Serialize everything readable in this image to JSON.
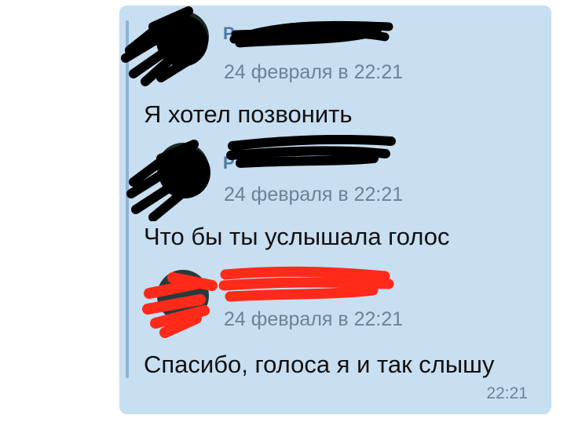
{
  "colors": {
    "bubble_bg": "#c8def1",
    "quote_bar": "#8fb3d4",
    "author": "#4a7aa8",
    "meta": "#6c8296",
    "text": "#111111",
    "redaction_black": "#000000",
    "redaction_red": "#ff2a1a"
  },
  "messages": [
    {
      "author_visible": "Р",
      "author_redaction": "black",
      "date": "24 февраля в 22:21",
      "text": "Я хотел позвонить"
    },
    {
      "author_visible": "Р",
      "author_redaction": "black",
      "date": "24 февраля в 22:21",
      "text": "Что бы ты услышала голос"
    },
    {
      "author_visible": "",
      "author_redaction": "red",
      "date": "24 февраля в 22:21",
      "text": "Спасибо, голоса я и так слышу"
    }
  ],
  "bubble": {
    "time": "22:21"
  }
}
